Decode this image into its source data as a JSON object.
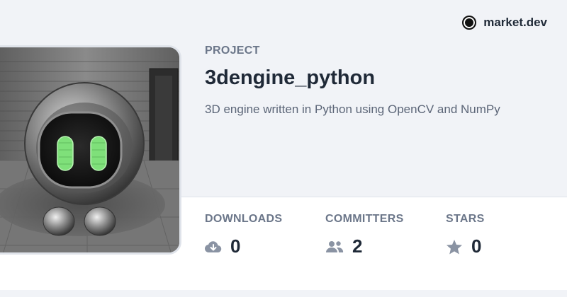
{
  "brand": {
    "name": "market.dev"
  },
  "project": {
    "section_label": "PROJECT",
    "title": "3dengine_python",
    "description": "3D engine written in Python using OpenCV and NumPy"
  },
  "stats": {
    "downloads": {
      "label": "DOWNLOADS",
      "value": "0",
      "icon": "cloud-download-icon"
    },
    "committers": {
      "label": "COMMITTERS",
      "value": "2",
      "icon": "users-icon"
    },
    "stars": {
      "label": "STARS",
      "value": "0",
      "icon": "star-icon"
    }
  },
  "colors": {
    "background": "#f1f3f7",
    "label": "#6b7689",
    "text": "#1f2937",
    "icon": "#8a93a3",
    "robot_eyes": "#7fe07a"
  }
}
